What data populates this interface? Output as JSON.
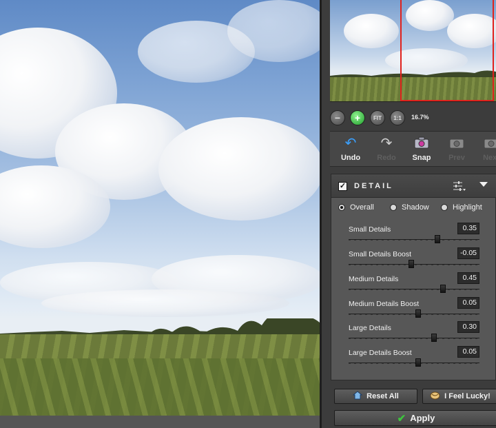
{
  "navigator": {
    "zoom_level": "16.7%"
  },
  "history": [
    {
      "label": "Undo",
      "icon": "undo-icon",
      "enabled": true
    },
    {
      "label": "Redo",
      "icon": "redo-icon",
      "enabled": false
    },
    {
      "label": "Snap",
      "icon": "camera-icon",
      "enabled": true
    },
    {
      "label": "Prev",
      "icon": "camera-prev-icon",
      "enabled": false
    },
    {
      "label": "Next",
      "icon": "camera-next-icon",
      "enabled": false
    }
  ],
  "detail": {
    "title": "DETAIL",
    "enabled": true,
    "modes": [
      {
        "label": "Overall",
        "selected": true
      },
      {
        "label": "Shadow",
        "selected": false
      },
      {
        "label": "Highlight",
        "selected": false
      }
    ],
    "sliders": [
      {
        "label": "Small Details",
        "value": "0.35",
        "position": 0.68
      },
      {
        "label": "Small Details Boost",
        "value": "-0.05",
        "position": 0.48
      },
      {
        "label": "Medium Details",
        "value": "0.45",
        "position": 0.72
      },
      {
        "label": "Medium Details Boost",
        "value": "0.05",
        "position": 0.53
      },
      {
        "label": "Large Details",
        "value": "0.30",
        "position": 0.65
      },
      {
        "label": "Large Details Boost",
        "value": "0.05",
        "position": 0.53
      }
    ]
  },
  "buttons": {
    "reset_all": "Reset All",
    "feel_lucky": "I Feel Lucky!",
    "apply": "Apply"
  },
  "colors": {
    "viewport_frame": "#e0211c",
    "apply_check": "#3ec43e",
    "zoom_in": "#1e9e2a"
  }
}
